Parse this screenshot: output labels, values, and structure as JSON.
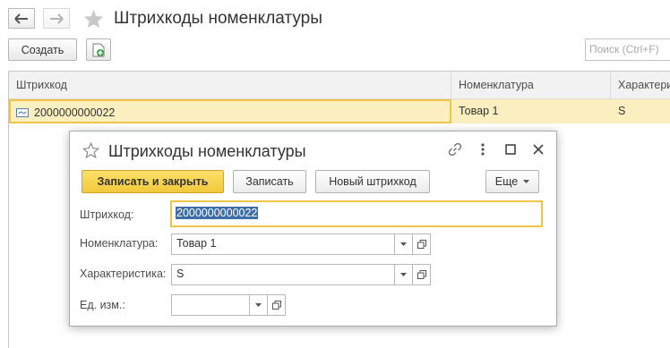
{
  "page": {
    "title": "Штрихкоды номенклатуры",
    "create_label": "Создать",
    "search_placeholder": "Поиск (Ctrl+F)"
  },
  "list": {
    "columns": [
      "Штрихкод",
      "Номенклатура",
      "Характеристика"
    ],
    "rows": [
      {
        "barcode": "2000000000022",
        "item": "Товар 1",
        "characteristic": "S"
      }
    ]
  },
  "modal": {
    "title": "Штрихкоды номенклатуры",
    "buttons": {
      "save_close": "Записать и закрыть",
      "save": "Записать",
      "new_barcode": "Новый штрихкод",
      "more": "Еще"
    },
    "fields": {
      "barcode_label": "Штрихкод:",
      "barcode_value": "2000000000022",
      "item_label": "Номенклатура:",
      "item_value": "Товар 1",
      "characteristic_label": "Характеристика:",
      "characteristic_value": "S",
      "unit_label": "Ед. изм.:",
      "unit_value": ""
    }
  },
  "colors": {
    "accent_yellow": "#f2c93a",
    "row_highlight": "#fbefbf",
    "selection_blue": "#3d6ea8"
  }
}
